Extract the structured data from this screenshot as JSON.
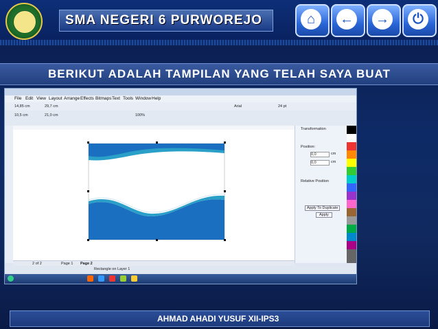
{
  "header": {
    "school_name": "SMA NEGERI 6 PURWOREJO",
    "nav": [
      {
        "name": "home-icon",
        "glyph": "⌂"
      },
      {
        "name": "back-icon",
        "glyph": "←"
      },
      {
        "name": "forward-icon",
        "glyph": "→"
      },
      {
        "name": "power-icon",
        "glyph": "⏻"
      }
    ]
  },
  "headline": "BERIKUT ADALAH TAMPILAN YANG TELAH SAYA BUAT",
  "app": {
    "menu": [
      "File",
      "Edit",
      "View",
      "Layout",
      "Arrange",
      "Effects",
      "Bitmaps",
      "Text",
      "Tools",
      "Window",
      "Help"
    ],
    "docker_title": "Transformation",
    "docker_position_label": "Position:",
    "docker_x": "0,0",
    "docker_y": "0,0",
    "docker_unit": "cm",
    "docker_relative": "Relative Position",
    "docker_apply_dup": "Apply To Duplicate",
    "docker_apply": "Apply",
    "page_counter": "2 of 2",
    "page_tab_1": "Page 1",
    "page_tab_2": "Page 2",
    "status_object": "Rectangle on Layer 1",
    "font_name": "Arial",
    "font_size": "24 pt",
    "zoom": "100%",
    "width_val": "29,7 cm",
    "height_val": "21,0 cm",
    "x_val": "14,85 cm",
    "y_val": "10,5 cm"
  },
  "footer": "AHMAD AHADI YUSUF XII-IPS3",
  "colors": {
    "accent": "#1c55c4",
    "wave_blue": "#1a6fc0",
    "wave_teal": "#2aa0c8",
    "bg": "#0e2a66"
  }
}
